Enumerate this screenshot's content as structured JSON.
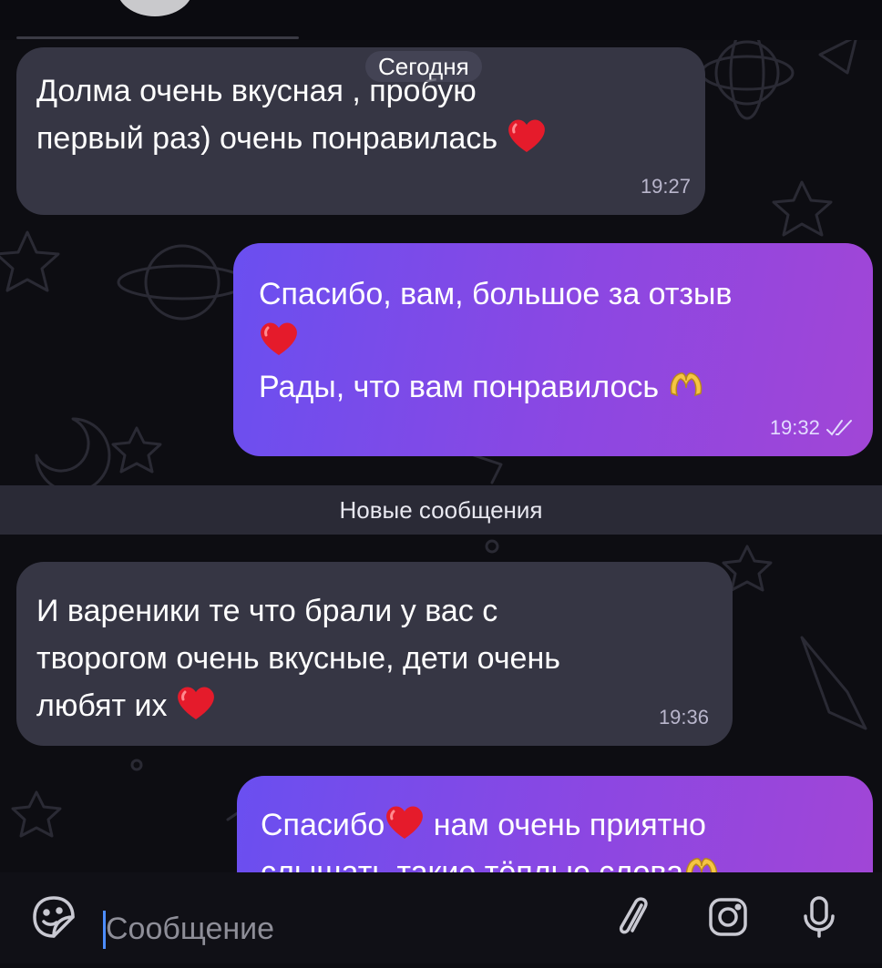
{
  "chat": {
    "date_label": "Сегодня",
    "new_messages_label": "Новые сообщения",
    "messages": [
      {
        "direction": "incoming",
        "lines": [
          "Долма очень вкусная , пробую",
          "первый раз) очень понравилась"
        ],
        "time": "19:27"
      },
      {
        "direction": "outgoing",
        "lines": [
          "Спасибо, вам, большое за отзыв",
          "",
          "Рады, что вам понравилось"
        ],
        "time": "19:32",
        "status": "read"
      },
      {
        "direction": "incoming",
        "lines": [
          "И вареники те что брали у вас с",
          "творогом очень вкусные, дети очень",
          "любят их"
        ],
        "time": "19:36"
      },
      {
        "direction": "outgoing",
        "lines": [
          "Спасибо",
          "нам очень приятно",
          "слышать такие тёплые слова"
        ],
        "time": ""
      }
    ]
  },
  "input": {
    "placeholder": "Сообщение",
    "value": ""
  },
  "icons": {
    "emoji": "sticker-emoji-icon",
    "attach": "paperclip-icon",
    "camera": "instagram-camera-icon",
    "mic": "microphone-icon",
    "heart": "red-heart-emoji",
    "hands": "heart-hands-emoji",
    "read": "double-check-icon"
  },
  "colors": {
    "incoming_bubble": "#363644",
    "outgoing_gradient_start": "#6a4ff0",
    "outgoing_gradient_end": "#a146d6",
    "background": "#0d0d12",
    "heart": "#e51b2b"
  }
}
